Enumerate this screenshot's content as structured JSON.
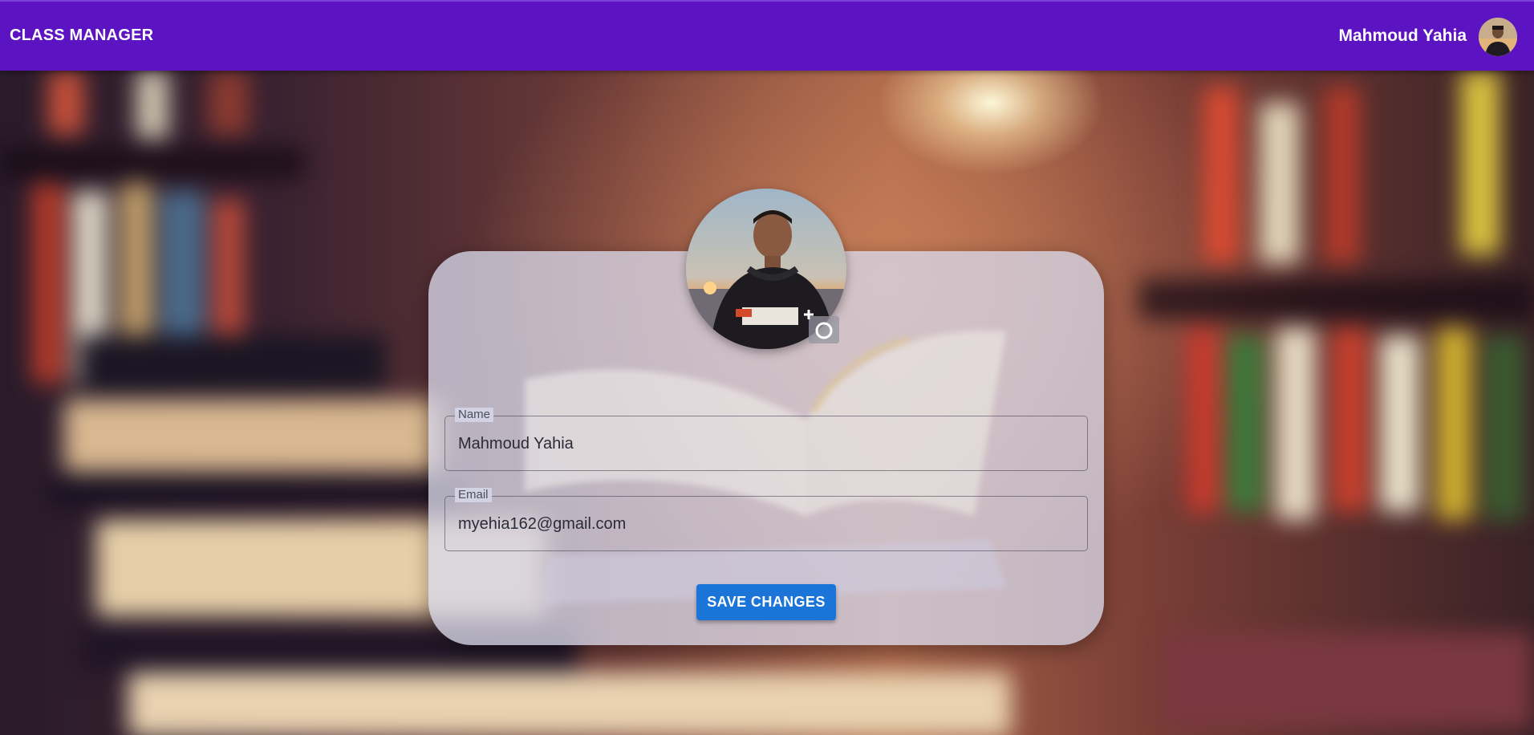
{
  "header": {
    "app_title": "CLASS MANAGER",
    "user_name": "Mahmoud Yahia",
    "avatar_icon": "user-avatar",
    "background_color": "#5c13c1"
  },
  "profile": {
    "avatar_icon": "profile-photo",
    "change_photo_icon": "add-photo-icon",
    "name_label": "Name",
    "name_value": "Mahmoud Yahia",
    "email_label": "Email",
    "email_value": "myehia162@gmail.com",
    "save_label": "SAVE CHANGES",
    "save_color": "#1b74d8"
  }
}
